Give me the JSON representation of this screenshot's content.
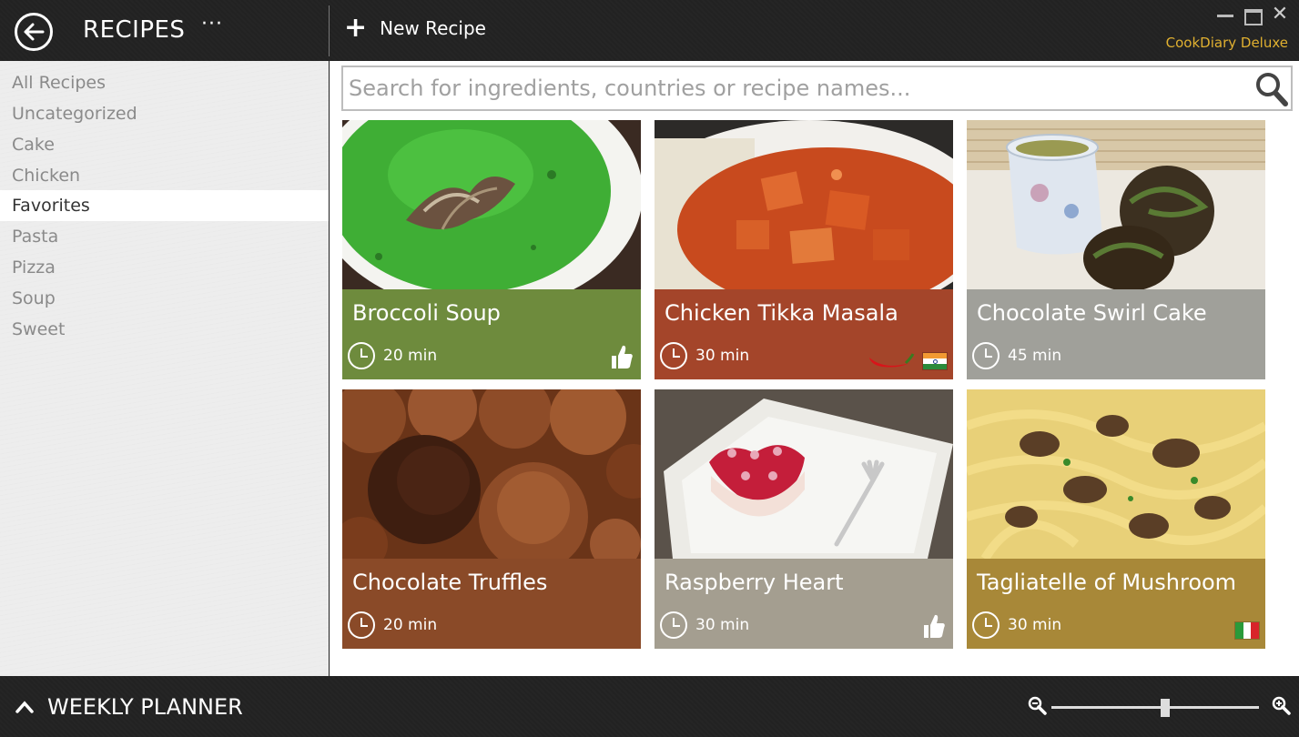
{
  "header": {
    "title": "RECIPES",
    "more": "···",
    "new_recipe_label": "New Recipe",
    "brand": "CookDiary Deluxe"
  },
  "sidebar": {
    "items": [
      {
        "label": "All Recipes"
      },
      {
        "label": "Uncategorized"
      },
      {
        "label": "Cake"
      },
      {
        "label": "Chicken"
      },
      {
        "label": "Favorites",
        "selected": true
      },
      {
        "label": "Pasta"
      },
      {
        "label": "Pizza"
      },
      {
        "label": "Soup"
      },
      {
        "label": "Sweet"
      }
    ]
  },
  "search": {
    "placeholder": "Search for ingredients, countries or recipe names..."
  },
  "recipes": [
    {
      "title": "Broccoli Soup",
      "time": "20 min",
      "color": "#6e8b3d",
      "icons": [
        "thumbs-up-icon"
      ]
    },
    {
      "title": "Chicken Tikka Masala",
      "time": "30 min",
      "color": "#a4452a",
      "icons": [
        "chili-icon",
        "india-flag-icon"
      ]
    },
    {
      "title": "Chocolate Swirl Cake",
      "time": "45 min",
      "color": "#a0a09a",
      "icons": []
    },
    {
      "title": "Chocolate Truffles",
      "time": "20 min",
      "color": "#8a4a28",
      "icons": []
    },
    {
      "title": "Raspberry Heart",
      "time": "30 min",
      "color": "#a49e90",
      "icons": [
        "thumbs-up-icon"
      ]
    },
    {
      "title": "Tagliatelle of Mushroom",
      "time": "30 min",
      "color": "#a88838",
      "icons": [
        "italy-flag-icon"
      ]
    }
  ],
  "footer": {
    "planner_label": "WEEKLY PLANNER",
    "zoom_level": 0.55
  }
}
